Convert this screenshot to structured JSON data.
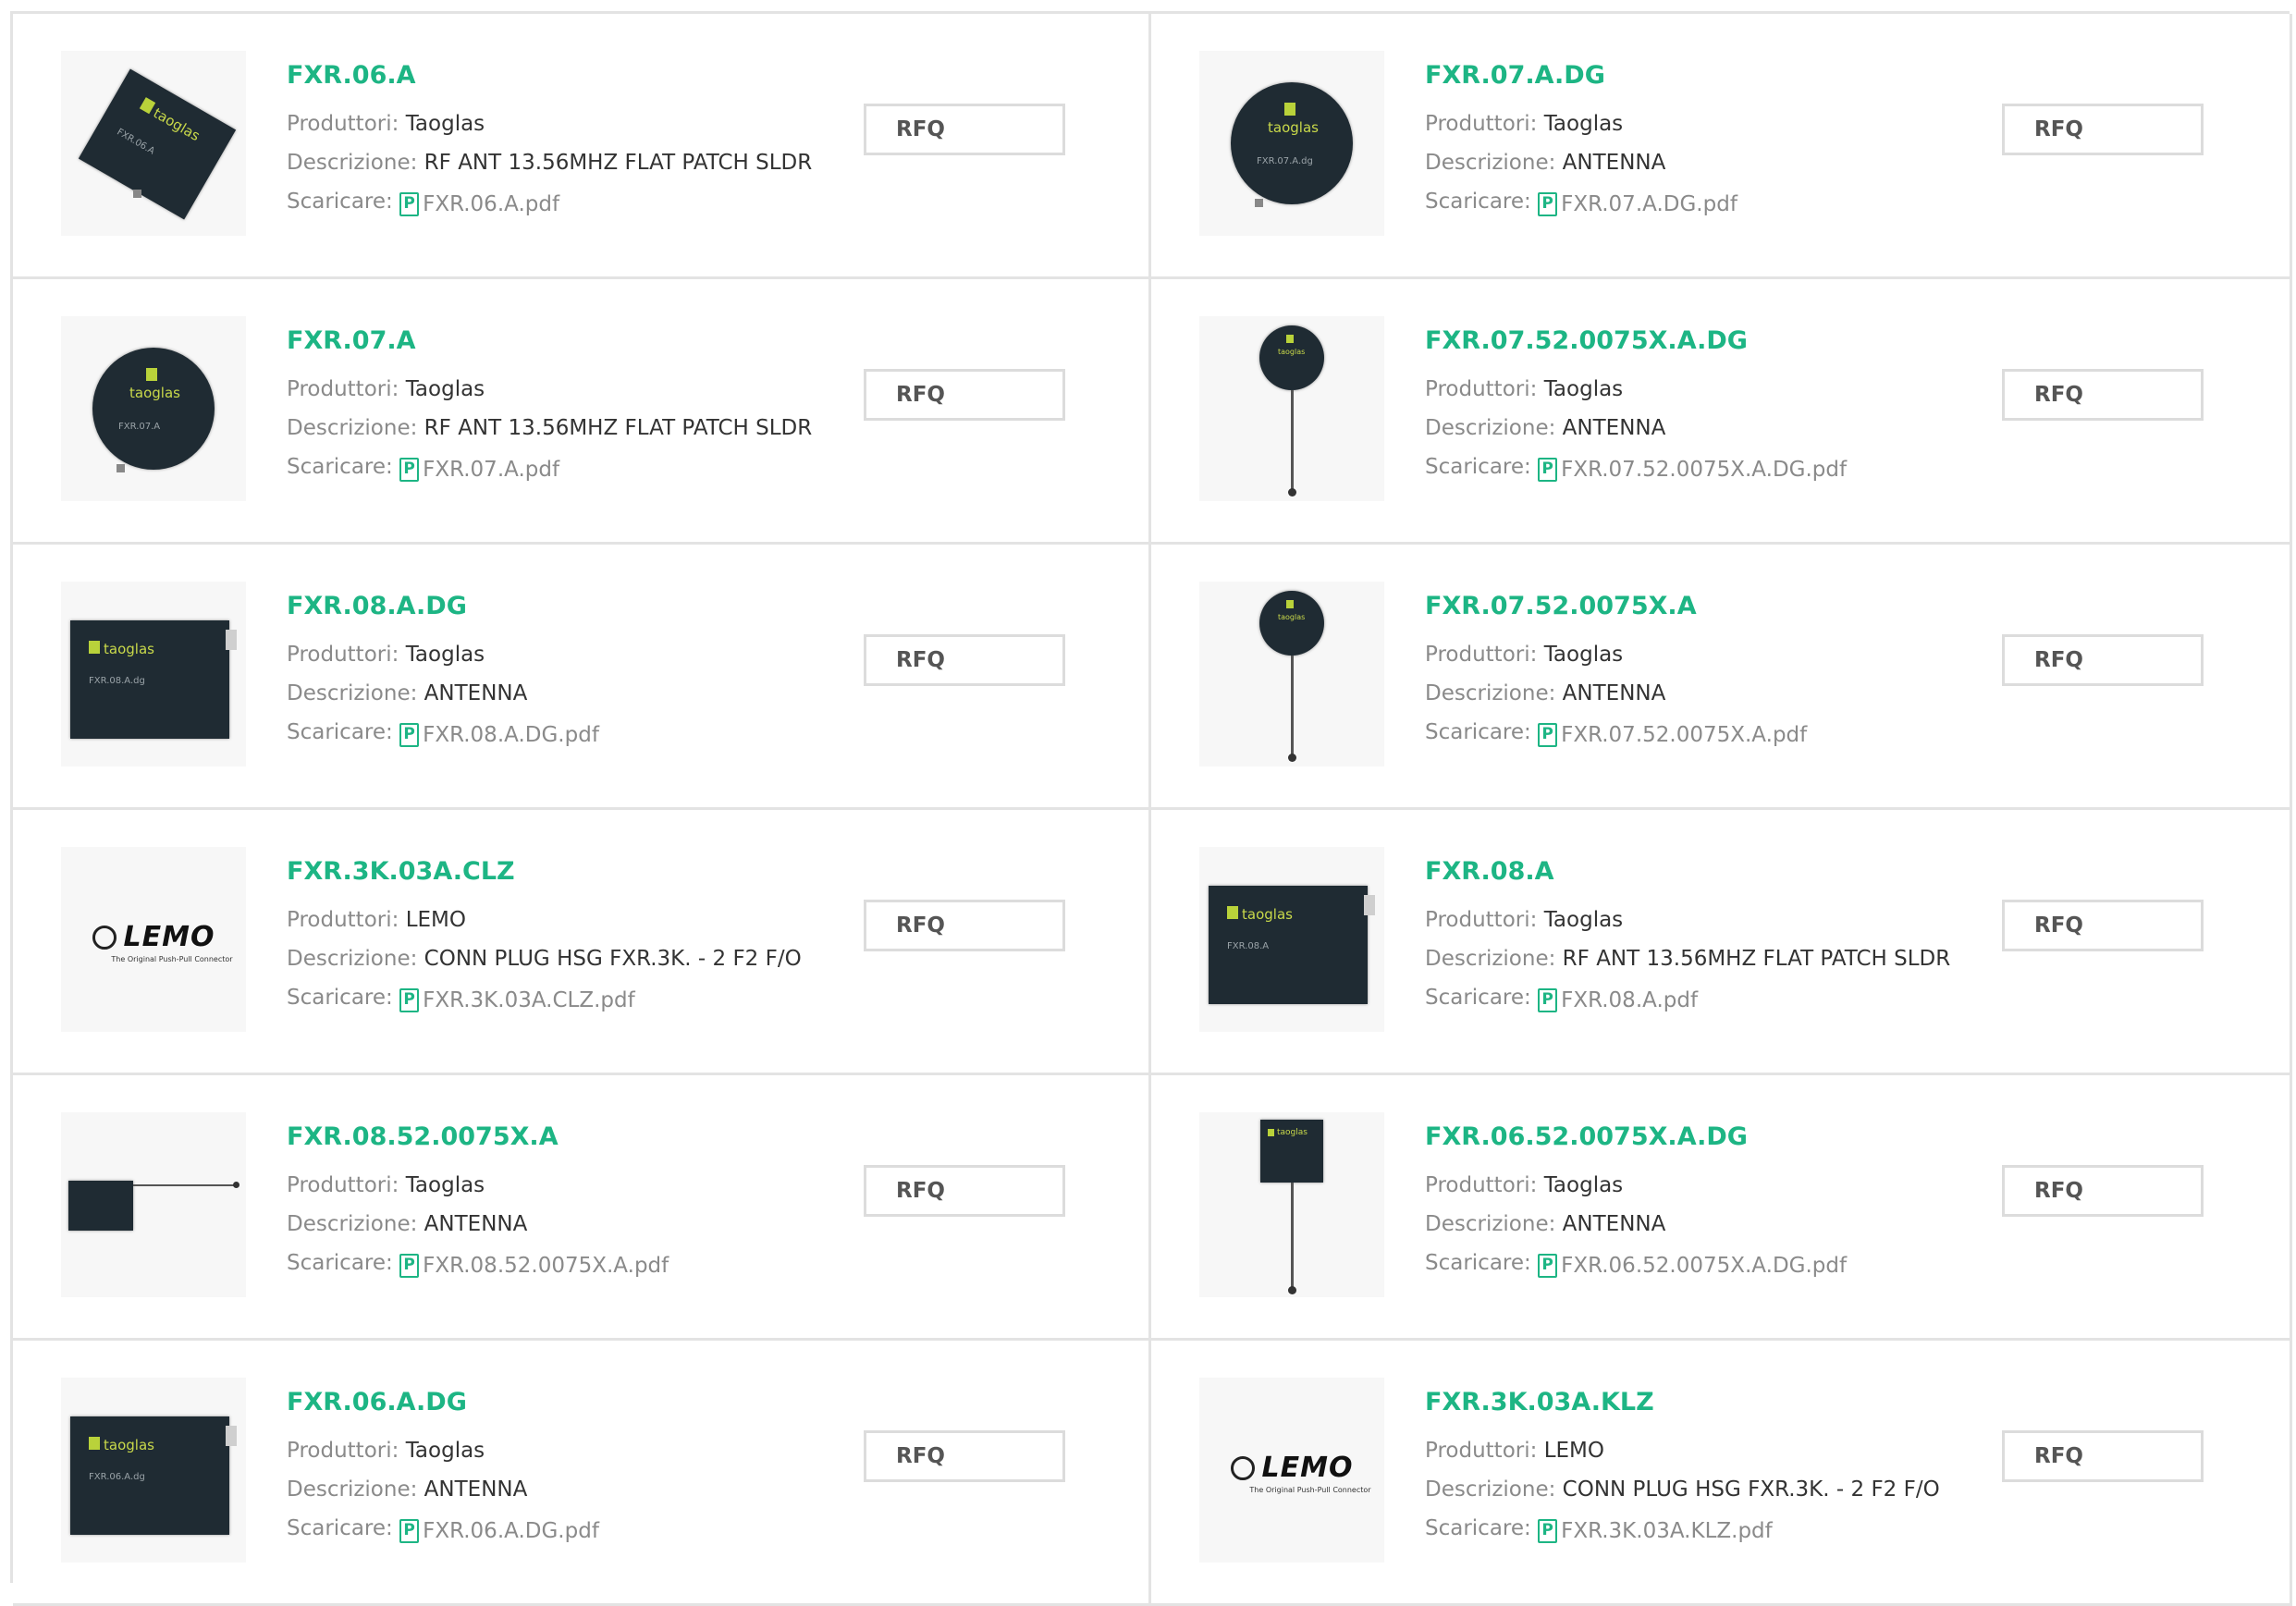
{
  "labels": {
    "manufacturer": "Produttori:",
    "description": "Descrizione:",
    "download": "Scaricare:",
    "rfq": "RFQ",
    "pdf_glyph": "P"
  },
  "colors": {
    "accent": "#1db584",
    "label_gray": "#8a8a8a",
    "border": "#e3e3e3"
  },
  "products": [
    {
      "name": "FXR.06.A",
      "manufacturer": "Taoglas",
      "description": "RF ANT 13.56MHZ FLAT PATCH SLDR",
      "file": "FXR.06.A.pdf"
    },
    {
      "name": "FXR.07.A.DG",
      "manufacturer": "Taoglas",
      "description": "ANTENNA",
      "file": "FXR.07.A.DG.pdf"
    },
    {
      "name": "FXR.07.A",
      "manufacturer": "Taoglas",
      "description": "RF ANT 13.56MHZ FLAT PATCH SLDR",
      "file": "FXR.07.A.pdf"
    },
    {
      "name": "FXR.07.52.0075X.A.DG",
      "manufacturer": "Taoglas",
      "description": "ANTENNA",
      "file": "FXR.07.52.0075X.A.DG.pdf"
    },
    {
      "name": "FXR.08.A.DG",
      "manufacturer": "Taoglas",
      "description": "ANTENNA",
      "file": "FXR.08.A.DG.pdf"
    },
    {
      "name": "FXR.07.52.0075X.A",
      "manufacturer": "Taoglas",
      "description": "ANTENNA",
      "file": "FXR.07.52.0075X.A.pdf"
    },
    {
      "name": "FXR.3K.03A.CLZ",
      "manufacturer": "LEMO",
      "description": "CONN PLUG HSG FXR.3K. - 2 F2 F/O",
      "file": "FXR.3K.03A.CLZ.pdf"
    },
    {
      "name": "FXR.08.A",
      "manufacturer": "Taoglas",
      "description": "RF ANT 13.56MHZ FLAT PATCH SLDR",
      "file": "FXR.08.A.pdf"
    },
    {
      "name": "FXR.08.52.0075X.A",
      "manufacturer": "Taoglas",
      "description": "ANTENNA",
      "file": "FXR.08.52.0075X.A.pdf"
    },
    {
      "name": "FXR.06.52.0075X.A.DG",
      "manufacturer": "Taoglas",
      "description": "ANTENNA",
      "file": "FXR.06.52.0075X.A.DG.pdf"
    },
    {
      "name": "FXR.06.A.DG",
      "manufacturer": "Taoglas",
      "description": "ANTENNA",
      "file": "FXR.06.A.DG.pdf"
    },
    {
      "name": "FXR.3K.03A.KLZ",
      "manufacturer": "LEMO",
      "description": "CONN PLUG HSG FXR.3K. - 2 F2 F/O",
      "file": "FXR.3K.03A.KLZ.pdf"
    }
  ],
  "images": [
    {
      "icon": "antenna-square-tilted-image",
      "brand": "taoglas",
      "part_print": "FXR.06.A"
    },
    {
      "icon": "antenna-round-image",
      "brand": "taoglas",
      "part_print": "FXR.07.A.dg"
    },
    {
      "icon": "antenna-round-image",
      "brand": "taoglas",
      "part_print": "FXR.07.A"
    },
    {
      "icon": "antenna-round-cable-image",
      "brand": "taoglas",
      "part_print": ""
    },
    {
      "icon": "antenna-square-image",
      "brand": "taoglas",
      "part_print": "FXR.08.A.dg"
    },
    {
      "icon": "antenna-round-cable-image",
      "brand": "taoglas",
      "part_print": ""
    },
    {
      "icon": "lemo-logo",
      "brand": "LEMO",
      "part_print": "The Original Push-Pull Connector"
    },
    {
      "icon": "antenna-square-image",
      "brand": "taoglas",
      "part_print": "FXR.08.A"
    },
    {
      "icon": "antenna-small-square-cable-image",
      "brand": "",
      "part_print": ""
    },
    {
      "icon": "antenna-small-square-cable-image",
      "brand": "taoglas",
      "part_print": ""
    },
    {
      "icon": "antenna-square-image",
      "brand": "taoglas",
      "part_print": "FXR.06.A.dg"
    },
    {
      "icon": "lemo-logo",
      "brand": "LEMO",
      "part_print": "The Original Push-Pull Connector"
    }
  ]
}
